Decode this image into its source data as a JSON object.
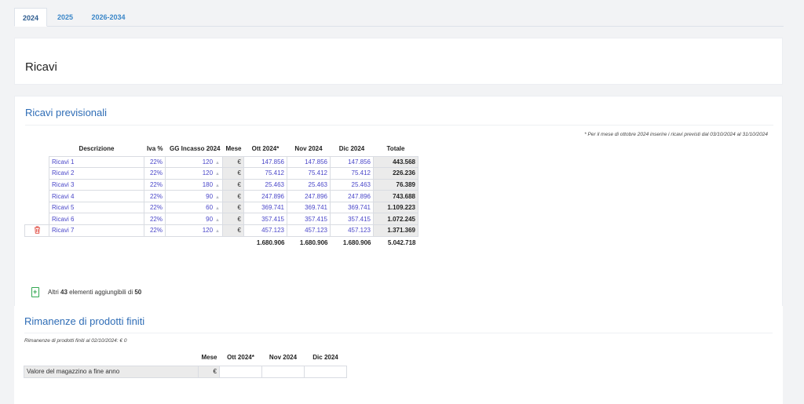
{
  "tabs": [
    {
      "label": "2024",
      "active": true
    },
    {
      "label": "2025",
      "active": false
    },
    {
      "label": "2026-2034",
      "active": false
    }
  ],
  "page_title": "Ricavi",
  "ricavi_previsionali": {
    "title": "Ricavi previsionali",
    "note": "* Per il mese di ottobre 2024 inserire i ricavi previsti dal 03/10/2024 al 31/10/2024",
    "headers": {
      "descrizione": "Descrizione",
      "iva": "Iva %",
      "gg_incasso": "GG Incasso 2024",
      "mese": "Mese",
      "m1": "Ott 2024*",
      "m2": "Nov 2024",
      "m3": "Dic 2024",
      "totale": "Totale"
    },
    "currency": "€",
    "rows": [
      {
        "desc": "Ricavi 1",
        "iva": "22%",
        "gg": "120",
        "m1": "147.856",
        "m2": "147.856",
        "m3": "147.856",
        "tot": "443.568"
      },
      {
        "desc": "Ricavi 2",
        "iva": "22%",
        "gg": "120",
        "m1": "75.412",
        "m2": "75.412",
        "m3": "75.412",
        "tot": "226.236"
      },
      {
        "desc": "Ricavi 3",
        "iva": "22%",
        "gg": "180",
        "m1": "25.463",
        "m2": "25.463",
        "m3": "25.463",
        "tot": "76.389"
      },
      {
        "desc": "Ricavi 4",
        "iva": "22%",
        "gg": "90",
        "m1": "247.896",
        "m2": "247.896",
        "m3": "247.896",
        "tot": "743.688"
      },
      {
        "desc": "Ricavi 5",
        "iva": "22%",
        "gg": "60",
        "m1": "369.741",
        "m2": "369.741",
        "m3": "369.741",
        "tot": "1.109.223"
      },
      {
        "desc": "Ricavi 6",
        "iva": "22%",
        "gg": "90",
        "m1": "357.415",
        "m2": "357.415",
        "m3": "357.415",
        "tot": "1.072.245"
      },
      {
        "desc": "Ricavi 7",
        "iva": "22%",
        "gg": "120",
        "m1": "457.123",
        "m2": "457.123",
        "m3": "457.123",
        "tot": "1.371.369"
      }
    ],
    "totals": {
      "m1": "1.680.906",
      "m2": "1.680.906",
      "m3": "1.680.906",
      "tot": "5.042.718"
    },
    "add_more": {
      "prefix": "Altri",
      "count": "43",
      "middle": "elementi aggiungibili di",
      "max": "50"
    }
  },
  "rimanenze": {
    "title": "Rimanenze di prodotti finiti",
    "note": "Rimanenze di prodotti finiti al 02/10/2024: € 0",
    "headers": {
      "mese": "Mese",
      "m1": "Ott 2024*",
      "m2": "Nov 2024",
      "m3": "Dic 2024"
    },
    "row_label": "Valore del magazzino a fine anno",
    "currency": "€",
    "values": {
      "m1": "",
      "m2": "",
      "m3": ""
    }
  },
  "colors": {
    "accent": "#2f6db6",
    "input_text": "#4a47c9",
    "delete": "#e0483e",
    "add": "#33a852"
  }
}
